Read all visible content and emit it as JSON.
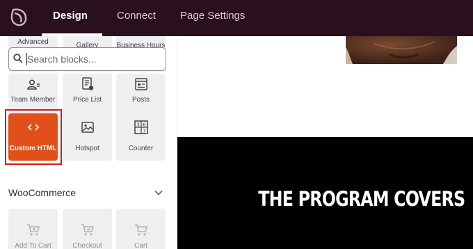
{
  "header": {
    "tabs": [
      {
        "label": "Design",
        "active": true
      },
      {
        "label": "Connect",
        "active": false
      },
      {
        "label": "Page Settings",
        "active": false
      }
    ],
    "background_color": "#2a0f1f"
  },
  "sidebar": {
    "search": {
      "placeholder": "Search blocks..."
    },
    "top_row_partial": [
      {
        "label": "Advanced",
        "icon": "advanced-icon"
      },
      {
        "label": "Gallery",
        "icon": "gallery-icon"
      },
      {
        "label": "Business Hours",
        "icon": "clock-icon"
      }
    ],
    "blocks": [
      {
        "label": "Team Member",
        "icon": "team-member-icon"
      },
      {
        "label": "Price List",
        "icon": "price-list-icon"
      },
      {
        "label": "Posts",
        "icon": "posts-icon"
      },
      {
        "label": "Custom HTML",
        "icon": "code-icon",
        "highlighted": true
      },
      {
        "label": "Hotspot",
        "icon": "hotspot-image-icon"
      },
      {
        "label": "Counter",
        "icon": "counter-icon"
      }
    ],
    "woocommerce": {
      "title": "WooCommerce",
      "blocks": [
        {
          "label": "Add To Cart",
          "icon": "cart-plus-icon"
        },
        {
          "label": "Checkout",
          "icon": "cart-checkout-icon"
        },
        {
          "label": "Cart",
          "icon": "cart-icon"
        }
      ]
    },
    "accent_color": "#e2501a",
    "highlight_color": "#d11a1a"
  },
  "canvas": {
    "heading": "THE PROGRAM COVERS"
  }
}
